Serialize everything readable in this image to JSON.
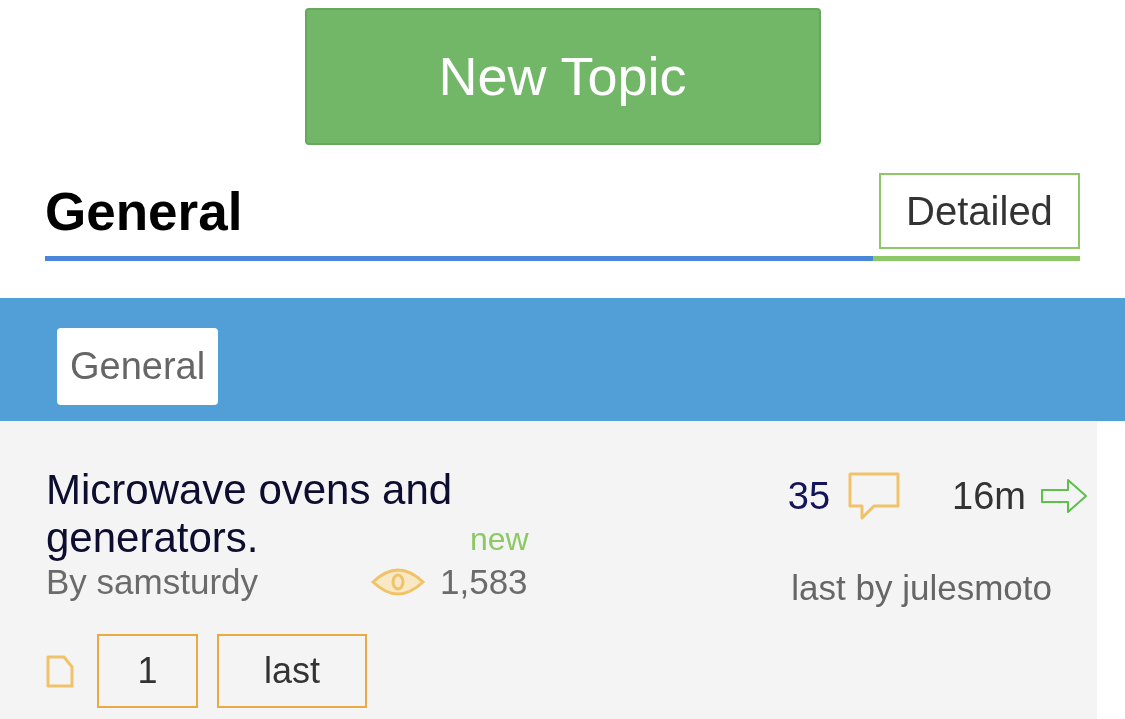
{
  "new_topic_button": {
    "label": "New Topic"
  },
  "header": {
    "title": "General",
    "view_toggle": {
      "label": "Detailed"
    }
  },
  "category_tabs": [
    {
      "label": "General",
      "selected": true
    }
  ],
  "topics": [
    {
      "title": "Microwave ovens and generators.",
      "badge": "new",
      "author": "By samsturdy",
      "views": "1,583",
      "pages": [
        {
          "label": "1"
        },
        {
          "label": "last"
        }
      ],
      "replies": "35",
      "last_post_time": "16m",
      "last_by": "last by julesmoto"
    }
  ]
}
